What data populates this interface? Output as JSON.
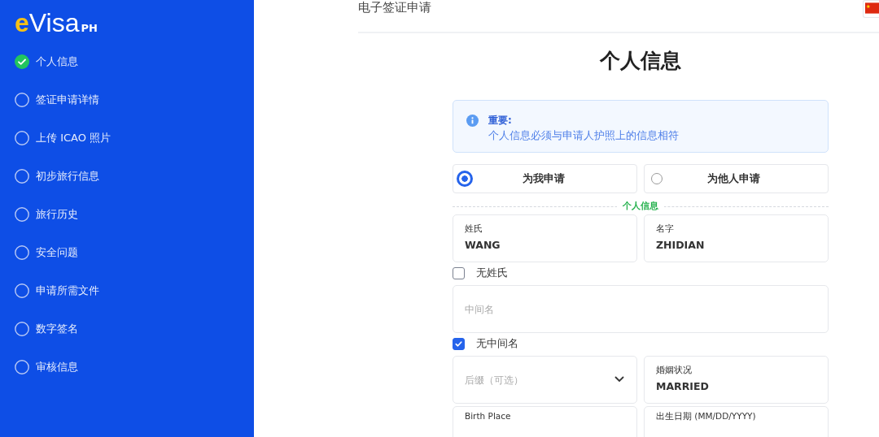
{
  "logo": {
    "parts": [
      {
        "text": "e",
        "kind": "accent"
      },
      {
        "text": "Visa",
        "kind": "main"
      },
      {
        "text": "PH",
        "kind": "suffix"
      }
    ]
  },
  "steps": [
    {
      "label": "个人信息",
      "completed": true
    },
    {
      "label": "签证申请详情",
      "completed": false
    },
    {
      "label": "上传 ICAO 照片",
      "completed": false
    },
    {
      "label": "初步旅行信息",
      "completed": false
    },
    {
      "label": "旅行历史",
      "completed": false
    },
    {
      "label": "安全问题",
      "completed": false
    },
    {
      "label": "申请所需文件",
      "completed": false
    },
    {
      "label": "数字签名",
      "completed": false
    },
    {
      "label": "审核信息",
      "completed": false
    }
  ],
  "header": {
    "title": "电子签证申请"
  },
  "page_title": "个人信息",
  "notice": {
    "heading": "重要:",
    "text": "个人信息必须与申请人护照上的信息相符"
  },
  "applicant_options": [
    {
      "label": "为我申请",
      "selected": true
    },
    {
      "label": "为他人申请",
      "selected": false
    }
  ],
  "section_label": "个人信息",
  "rows": [
    {
      "kind": "fields",
      "fields": [
        {
          "kind": "text",
          "label": "姓氏",
          "value": "WANG"
        },
        {
          "kind": "text",
          "label": "名字",
          "value": "ZHIDIAN"
        }
      ]
    },
    {
      "kind": "checkbox",
      "label": "无姓氏",
      "checked": false
    },
    {
      "kind": "fields",
      "fields": [
        {
          "kind": "text",
          "placeholder": "中间名"
        }
      ]
    },
    {
      "kind": "checkbox",
      "label": "无中间名",
      "checked": true
    },
    {
      "kind": "fields",
      "fields": [
        {
          "kind": "select",
          "placeholder": "后缀（可选）"
        },
        {
          "kind": "text",
          "label": "婚姻状况",
          "value": "MARRIED"
        }
      ]
    },
    {
      "kind": "fields",
      "fields": [
        {
          "kind": "text",
          "label": "Birth Place"
        },
        {
          "kind": "text",
          "label": "出生日期 (MM/DD/YYYY)"
        }
      ]
    }
  ]
}
